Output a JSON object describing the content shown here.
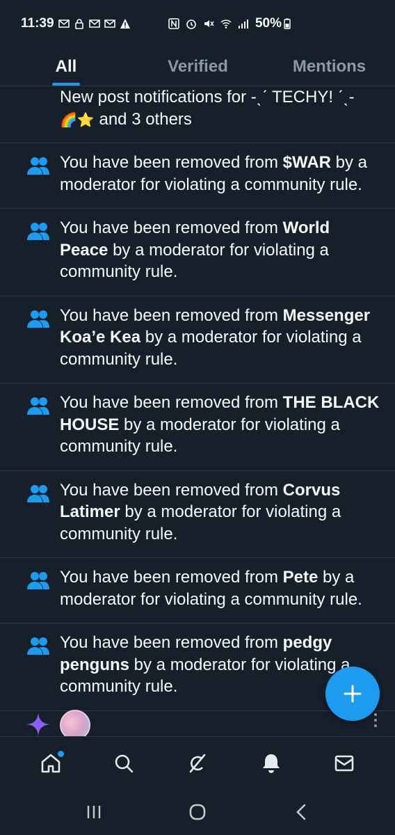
{
  "status": {
    "time": "11:39",
    "battery": "50%"
  },
  "tabs": [
    {
      "label": "All"
    },
    {
      "label": "Verified"
    },
    {
      "label": "Mentions"
    }
  ],
  "first_item": {
    "line1": "New post notifications for -ˎˊ TECHY! ˊˎ-",
    "line2_emoji": "🌈⭐",
    "line2_text": " and 3 others"
  },
  "notifications": [
    {
      "prefix": "You have been removed from ",
      "community": "$WAR",
      "suffix": " by a moderator for violating a community rule."
    },
    {
      "prefix": "You have been removed from ",
      "community": "World Peace",
      "suffix": " by a moderator for violating a community rule."
    },
    {
      "prefix": "You have been removed from ",
      "community": "Messenger Koa’e Kea",
      "suffix": " by a moderator for violating a community rule."
    },
    {
      "prefix": "You have been removed from ",
      "community": "THE BLACK HOUSE",
      "suffix": " by a moderator for violating a community rule."
    },
    {
      "prefix": "You have been removed from ",
      "community": "Corvus Latimer",
      "suffix": " by a moderator for violating a community rule."
    },
    {
      "prefix": "You have been removed from ",
      "community": "Pete",
      "suffix": " by a moderator for violating a community rule."
    },
    {
      "prefix": "You have been removed from ",
      "community": "pedgy penguns",
      "suffix": " by a moderator for violating a community rule."
    }
  ],
  "icons": {
    "community": "community-icon",
    "spark": "sparkle-icon",
    "compose": "plus-icon",
    "nav": [
      "home-icon",
      "search-icon",
      "grok-icon",
      "bell-icon",
      "mail-icon"
    ],
    "system": [
      "recents-icon",
      "home-circle-icon",
      "back-icon"
    ]
  },
  "colors": {
    "background": "#15202b",
    "accent": "#1d9bf0",
    "muted": "#8b98a5",
    "text": "#f7f9f9"
  }
}
